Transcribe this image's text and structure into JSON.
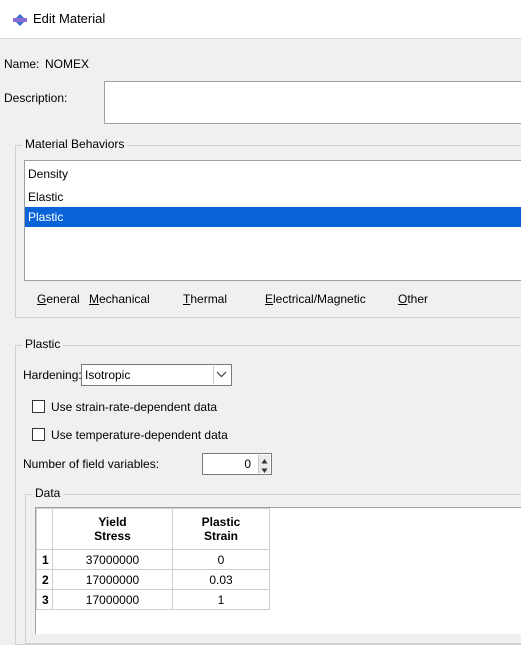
{
  "window": {
    "title": "Edit Material",
    "icon": "material-icon"
  },
  "name": {
    "label": "Name:",
    "value": "NOMEX"
  },
  "description": {
    "label": "Description:",
    "value": ""
  },
  "behaviors": {
    "legend": "Material Behaviors",
    "items": [
      {
        "label": "Density",
        "selected": false
      },
      {
        "label": "Elastic",
        "selected": false
      },
      {
        "label": "Plastic",
        "selected": true
      }
    ]
  },
  "menu": {
    "items": [
      {
        "label": "General",
        "mnemonic": "G"
      },
      {
        "label": "Mechanical",
        "mnemonic": "M"
      },
      {
        "label": "Thermal",
        "mnemonic": "T"
      },
      {
        "label": "Electrical/Magnetic",
        "mnemonic": "E"
      },
      {
        "label": "Other",
        "mnemonic": "O"
      }
    ]
  },
  "plastic": {
    "legend": "Plastic",
    "hardening_label": "Hardening:",
    "hardening_value": "Isotropic",
    "strain_rate_label": "Use strain-rate-dependent data",
    "strain_rate_checked": false,
    "temperature_label": "Use temperature-dependent data",
    "temperature_checked": false,
    "field_vars_label": "Number of field variables:",
    "field_vars_value": "0"
  },
  "data": {
    "legend": "Data",
    "columns": [
      "Yield\nStress",
      "Plastic\nStrain"
    ],
    "rows": [
      {
        "n": "1",
        "yield": "37000000",
        "strain": "0"
      },
      {
        "n": "2",
        "yield": "17000000",
        "strain": "0.03"
      },
      {
        "n": "3",
        "yield": "17000000",
        "strain": "1"
      }
    ]
  },
  "colors": {
    "selection": "#0a64d8",
    "background": "#f0f0f0"
  }
}
